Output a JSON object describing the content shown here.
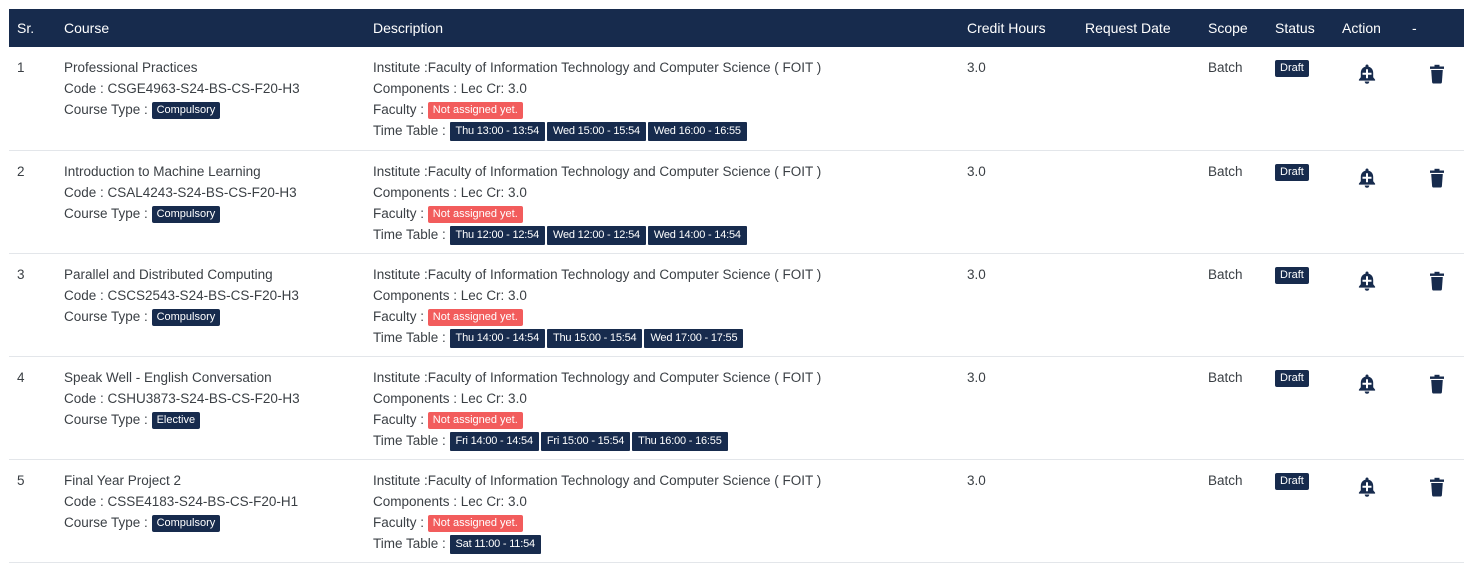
{
  "table": {
    "headers": {
      "sr": "Sr.",
      "course": "Course",
      "description": "Description",
      "credit_hours": "Credit Hours",
      "request_date": "Request Date",
      "scope": "Scope",
      "status": "Status",
      "action": "Action",
      "extra": "-"
    },
    "rows": [
      {
        "sr": "1",
        "course_name": "Professional Practices",
        "code": "Code : CSGE4963-S24-BS-CS-F20-H3",
        "course_type_label": "Course Type :",
        "course_type": "Compulsory",
        "institute": "Institute :Faculty of Information Technology and Computer Science ( FOIT )",
        "components": "Components : Lec Cr: 3.0",
        "faculty_label": "Faculty :",
        "faculty": "Not assigned yet.",
        "timetable_label": "Time Table :",
        "timetable": [
          "Thu 13:00 - 13:54",
          "Wed 15:00 - 15:54",
          "Wed 16:00 - 16:55"
        ],
        "credit_hours": "3.0",
        "request_date": "",
        "scope": "Batch",
        "status": "Draft"
      },
      {
        "sr": "2",
        "course_name": "Introduction to Machine Learning",
        "code": "Code : CSAL4243-S24-BS-CS-F20-H3",
        "course_type_label": "Course Type :",
        "course_type": "Compulsory",
        "institute": "Institute :Faculty of Information Technology and Computer Science ( FOIT )",
        "components": "Components : Lec Cr: 3.0",
        "faculty_label": "Faculty :",
        "faculty": "Not assigned yet.",
        "timetable_label": "Time Table :",
        "timetable": [
          "Thu 12:00 - 12:54",
          "Wed 12:00 - 12:54",
          "Wed 14:00 - 14:54"
        ],
        "credit_hours": "3.0",
        "request_date": "",
        "scope": "Batch",
        "status": "Draft"
      },
      {
        "sr": "3",
        "course_name": "Parallel and Distributed Computing",
        "code": "Code : CSCS2543-S24-BS-CS-F20-H3",
        "course_type_label": "Course Type :",
        "course_type": "Compulsory",
        "institute": "Institute :Faculty of Information Technology and Computer Science ( FOIT )",
        "components": "Components : Lec Cr: 3.0",
        "faculty_label": "Faculty :",
        "faculty": "Not assigned yet.",
        "timetable_label": "Time Table :",
        "timetable": [
          "Thu 14:00 - 14:54",
          "Thu 15:00 - 15:54",
          "Wed 17:00 - 17:55"
        ],
        "credit_hours": "3.0",
        "request_date": "",
        "scope": "Batch",
        "status": "Draft"
      },
      {
        "sr": "4",
        "course_name": "Speak Well - English Conversation",
        "code": "Code : CSHU3873-S24-BS-CS-F20-H3",
        "course_type_label": "Course Type :",
        "course_type": "Elective",
        "institute": "Institute :Faculty of Information Technology and Computer Science ( FOIT )",
        "components": "Components : Lec Cr: 3.0",
        "faculty_label": "Faculty :",
        "faculty": "Not assigned yet.",
        "timetable_label": "Time Table :",
        "timetable": [
          "Fri 14:00 - 14:54",
          "Fri 15:00 - 15:54",
          "Thu 16:00 - 16:55"
        ],
        "credit_hours": "3.0",
        "request_date": "",
        "scope": "Batch",
        "status": "Draft"
      },
      {
        "sr": "5",
        "course_name": "Final Year Project 2",
        "code": "Code : CSSE4183-S24-BS-CS-F20-H1",
        "course_type_label": "Course Type :",
        "course_type": "Compulsory",
        "institute": "Institute :Faculty of Information Technology and Computer Science ( FOIT )",
        "components": "Components : Lec Cr: 3.0",
        "faculty_label": "Faculty :",
        "faculty": "Not assigned yet.",
        "timetable_label": "Time Table :",
        "timetable": [
          "Sat 11:00 - 11:54"
        ],
        "credit_hours": "3.0",
        "request_date": "",
        "scope": "Batch",
        "status": "Draft"
      }
    ]
  },
  "icons": {
    "notify": "bell-plus-icon",
    "delete": "trash-icon"
  },
  "colors": {
    "header_bg": "#172b4d",
    "badge_navy": "#172b4d",
    "badge_red": "#f25c5c"
  }
}
